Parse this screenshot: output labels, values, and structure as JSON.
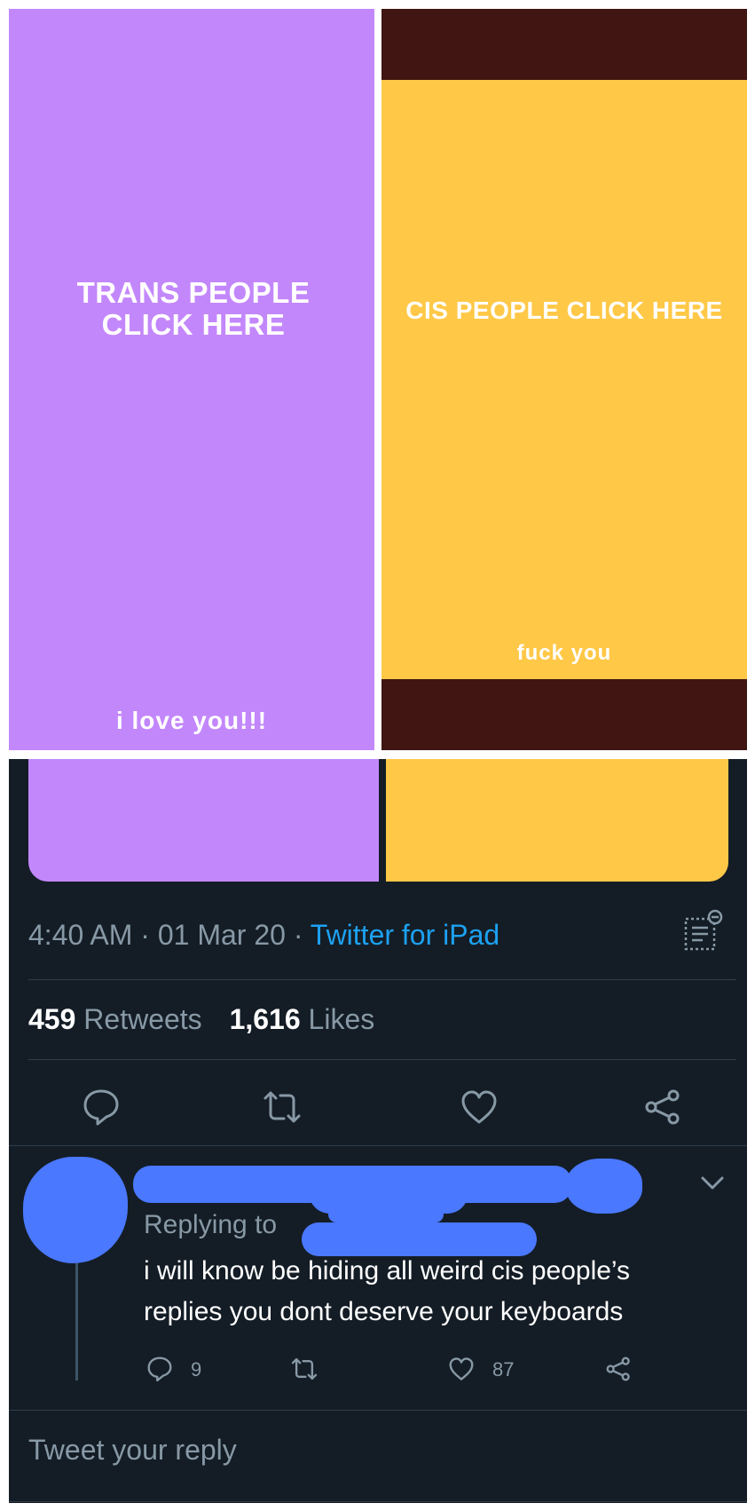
{
  "meme": {
    "trans_headline": "TRANS PEOPLE CLICK HERE",
    "trans_caption": "i love you!!!",
    "cis_headline": "CIS PEOPLE CLICK HERE",
    "cis_caption": "fuck you"
  },
  "tweet": {
    "time": "4:40 AM",
    "date": "01 Mar 20",
    "source": "Twitter for iPad",
    "retweets_count": "459",
    "retweets_label": "Retweets",
    "likes_count": "1,616",
    "likes_label": "Likes"
  },
  "reply": {
    "replying_to": "Replying to",
    "text_line1": "i will know be hiding all weird cis people’s",
    "text_line2": "replies you dont deserve your keyboards",
    "reply_count": "9",
    "like_count": "87"
  },
  "composer": {
    "placeholder": "Tweet your reply"
  },
  "colors": {
    "purple": "#c387fc",
    "yellow": "#ffc847",
    "dark_brown": "#401512",
    "twitter_bg": "#141d26",
    "twitter_blue": "#1da1f2",
    "muted": "#8899a6",
    "redaction_blue": "#4a78ff"
  },
  "icons": {
    "analytics": "analytics-icon",
    "reply": "speech-bubble-icon",
    "retweet": "retweet-icon",
    "like": "heart-icon",
    "share": "share-icon",
    "more": "chevron-down-icon"
  }
}
